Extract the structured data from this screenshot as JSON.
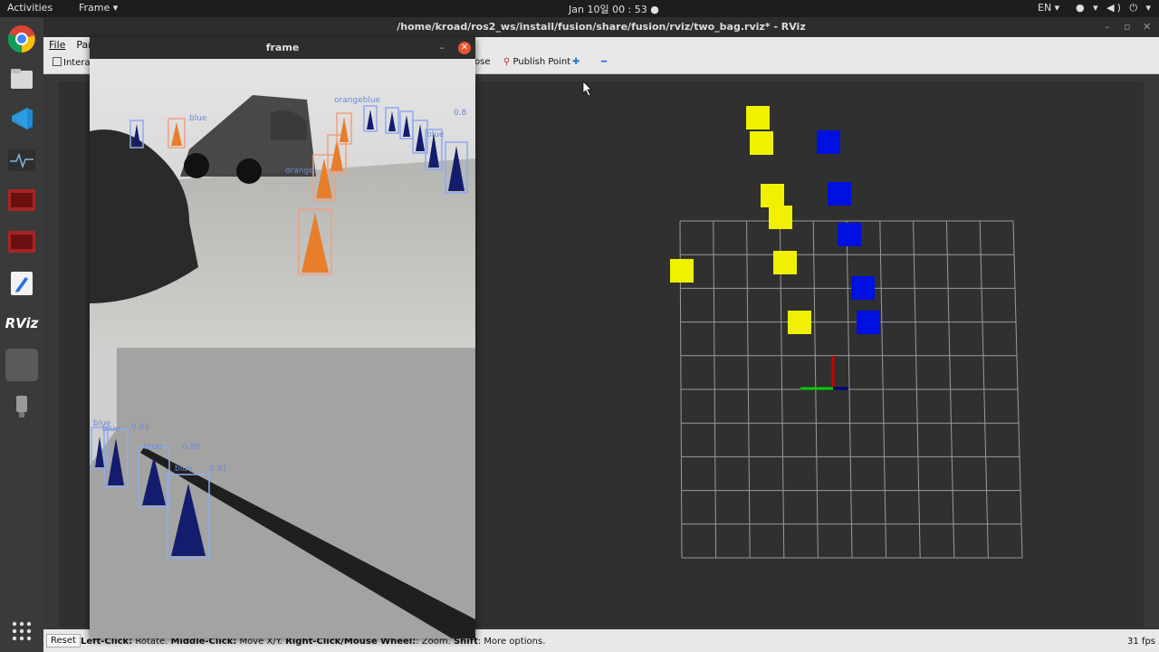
{
  "topbar": {
    "activities": "Activities",
    "app_menu": "Frame ▾",
    "clock": "Jan 10일  00 : 53  ●",
    "language": "EN ▾",
    "tray": "● ▾ ◀) ⏻ ▾"
  },
  "dock": {
    "items": [
      "chrome-icon",
      "files-icon",
      "vscode-icon",
      "system-monitor-icon",
      "terminal-icon",
      "terminal-icon",
      "text-editor-icon",
      "rviz-icon",
      "frame-icon",
      "usb-drive-icon",
      "app-grid-icon"
    ],
    "rviz_label": "RViz"
  },
  "rviz": {
    "title": "/home/kroad/ros2_ws/install/fusion/share/fusion/rviz/two_bag.rviz* - RViz",
    "minimize": "–",
    "maximize": "▫",
    "close": "✕",
    "menu": [
      "File",
      "Panels"
    ],
    "toolbar": {
      "interact": "Interact",
      "pose": "ose",
      "publish_point": "Publish Point",
      "plus": "✚",
      "minus": "━"
    },
    "status": {
      "reset": "Reset",
      "hint_left": "Left-Click:",
      "hint_left_v": " Rotate. ",
      "hint_mid": "Middle-Click:",
      "hint_mid_v": " Move X/Y. ",
      "hint_right": "Right-Click/Mouse Wheel:",
      "hint_right_v": ": Zoom. ",
      "hint_shift": "Shift",
      "hint_shift_v": ": More options.",
      "fps": "31 fps"
    }
  },
  "frame_window": {
    "title": "frame",
    "minimize": "–",
    "close": "✕",
    "cam1_labels": [
      "orange",
      "orangeblue",
      "blue",
      "0.8",
      "blue"
    ],
    "cam2_labels": [
      "blue",
      "blue",
      "0.81",
      "blue",
      "0.89",
      "blue",
      "0.91"
    ]
  },
  "viz": {
    "yellow_color": "#f0f000",
    "blue_color": "#0010e0",
    "grid_color": "#9a9a9a"
  }
}
